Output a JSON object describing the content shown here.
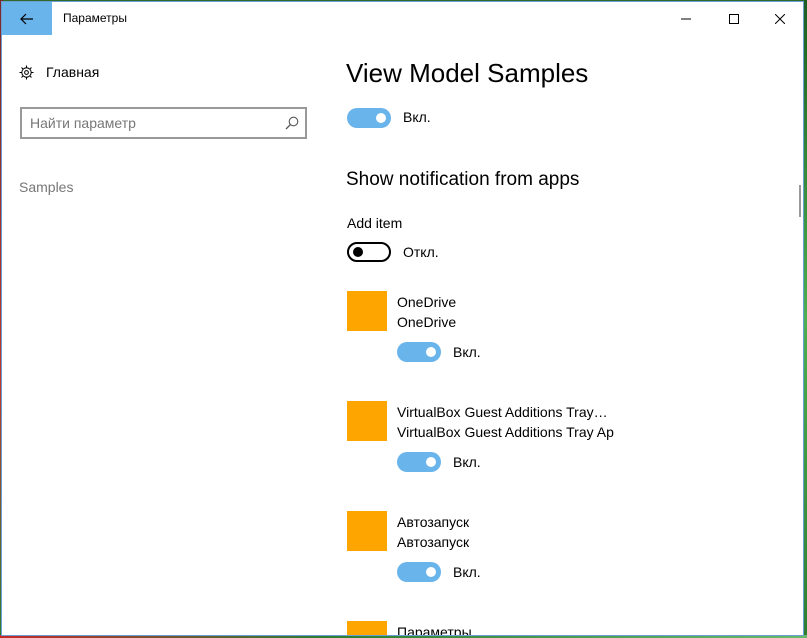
{
  "window": {
    "title": "Параметры"
  },
  "sidebar": {
    "home_label": "Главная",
    "search_placeholder": "Найти параметр",
    "items": [
      {
        "label": "Samples"
      }
    ]
  },
  "main": {
    "title": "View Model Samples",
    "master_toggle": {
      "state": "Вкл.",
      "on": true
    },
    "section_title": "Show notification from apps",
    "add_item": {
      "label": "Add item",
      "state": "Откл.",
      "on": false
    },
    "apps": [
      {
        "name": "OneDrive",
        "subtitle": "OneDrive",
        "state": "Вкл.",
        "on": true
      },
      {
        "name": "VirtualBox Guest Additions Tray…",
        "subtitle": "VirtualBox Guest Additions Tray Ap",
        "state": "Вкл.",
        "on": true
      },
      {
        "name": "Автозапуск",
        "subtitle": "Автозапуск",
        "state": "Вкл.",
        "on": true
      },
      {
        "name": "Параметры"
      }
    ]
  },
  "colors": {
    "accent": "#6ab4ec",
    "app_tile": "#ffa500"
  }
}
